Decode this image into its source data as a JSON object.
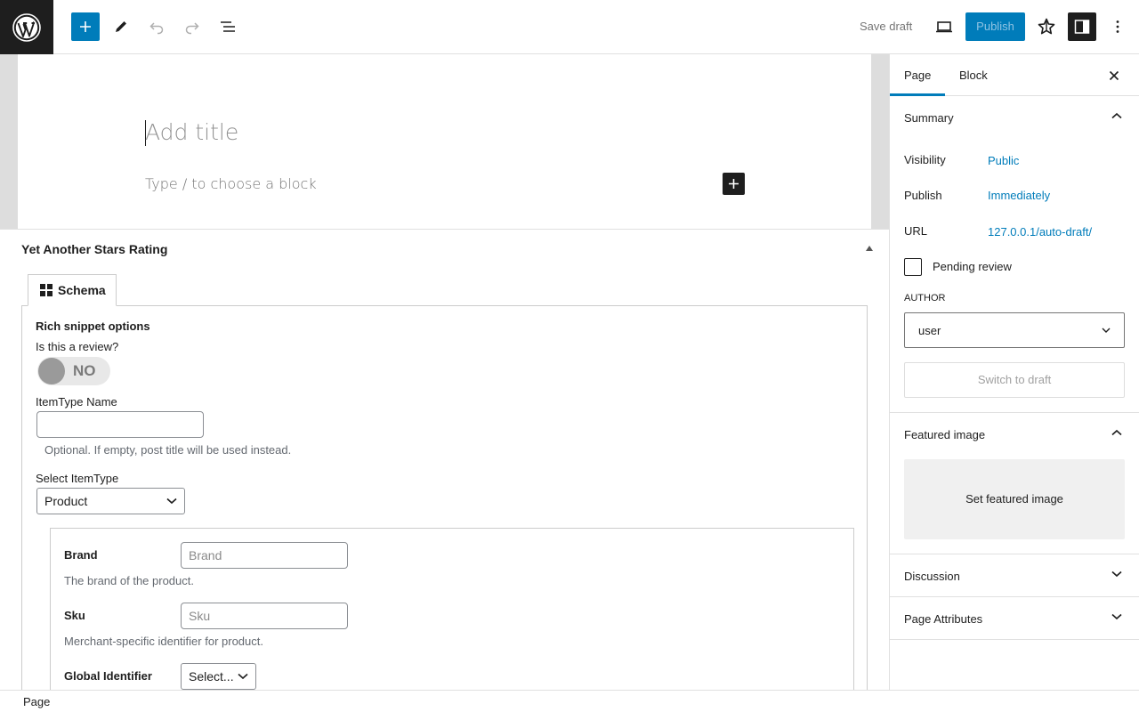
{
  "toolbar": {
    "save_draft": "Save draft",
    "publish": "Publish"
  },
  "editor": {
    "title_placeholder": "Add title",
    "block_placeholder": "Type / to choose a block"
  },
  "metabox": {
    "title": "Yet Another Stars Rating",
    "tab_label": "Schema",
    "rich_snippet_title": "Rich snippet options",
    "review_question": "Is this a review?",
    "review_toggle": "NO",
    "itemtype_name_label": "ItemType Name",
    "itemtype_name_help": "Optional. If empty, post title will be used instead.",
    "select_itemtype_label": "Select ItemType",
    "select_itemtype_value": "Product",
    "fields": {
      "brand_label": "Brand",
      "brand_placeholder": "Brand",
      "brand_help": "The brand of the product.",
      "sku_label": "Sku",
      "sku_placeholder": "Sku",
      "sku_help": "Merchant-specific identifier for product.",
      "gid_label": "Global Identifier",
      "gid_value": "Select..."
    }
  },
  "sidebar": {
    "tabs": [
      "Page",
      "Block"
    ],
    "summary": {
      "title": "Summary",
      "visibility_label": "Visibility",
      "visibility_value": "Public",
      "publish_label": "Publish",
      "publish_value": "Immediately",
      "url_label": "URL",
      "url_value": "127.0.0.1/auto-draft/",
      "pending_label": "Pending review",
      "author_label": "AUTHOR",
      "author_value": "user",
      "switch_draft": "Switch to draft"
    },
    "featured": {
      "title": "Featured image",
      "set_label": "Set featured image"
    },
    "discussion": "Discussion",
    "page_attributes": "Page Attributes"
  },
  "footer": {
    "breadcrumb": "Page"
  },
  "colors": {
    "accent": "#007cba",
    "dark": "#1e1e1e"
  }
}
